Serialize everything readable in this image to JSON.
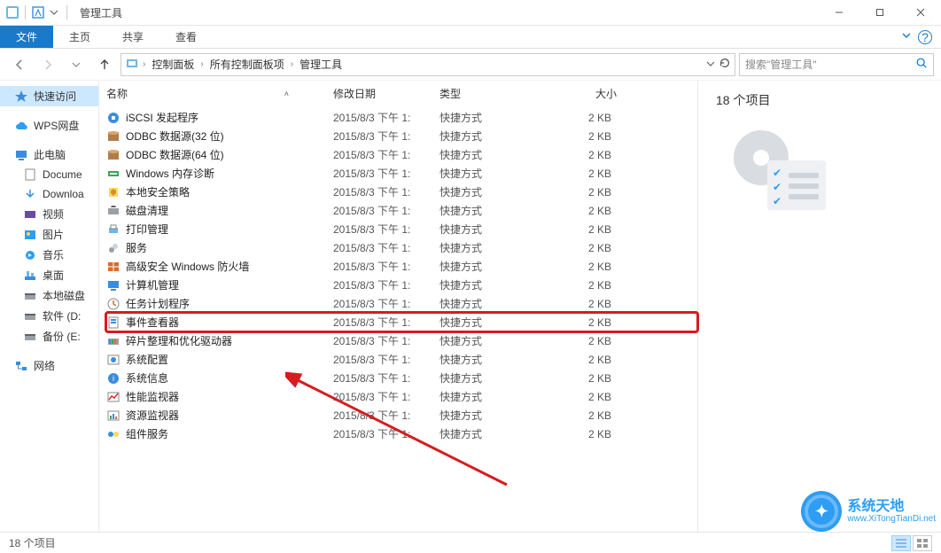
{
  "window": {
    "title": "管理工具"
  },
  "ribbon": {
    "file": "文件",
    "tabs": [
      "主页",
      "共享",
      "查看"
    ]
  },
  "address": {
    "crumbs": [
      "控制面板",
      "所有控制面板项",
      "管理工具"
    ]
  },
  "search": {
    "placeholder": "搜索\"管理工具\""
  },
  "sidebar": {
    "quick_access": "快速访问",
    "wps": "WPS网盘",
    "this_pc": "此电脑",
    "this_pc_children": [
      "Docume",
      "Downloa",
      "视频",
      "图片",
      "音乐",
      "桌面",
      "本地磁盘",
      "软件 (D:",
      "备份 (E:"
    ],
    "network": "网络"
  },
  "columns": {
    "name": "名称",
    "date": "修改日期",
    "type": "类型",
    "size": "大小"
  },
  "files": [
    {
      "name": "iSCSI 发起程序",
      "date": "2015/8/3 下午 1:",
      "type": "快捷方式",
      "size": "2 KB",
      "icon": "iscsi"
    },
    {
      "name": "ODBC 数据源(32 位)",
      "date": "2015/8/3 下午 1:",
      "type": "快捷方式",
      "size": "2 KB",
      "icon": "odbc"
    },
    {
      "name": "ODBC 数据源(64 位)",
      "date": "2015/8/3 下午 1:",
      "type": "快捷方式",
      "size": "2 KB",
      "icon": "odbc"
    },
    {
      "name": "Windows 内存诊断",
      "date": "2015/8/3 下午 1:",
      "type": "快捷方式",
      "size": "2 KB",
      "icon": "mem"
    },
    {
      "name": "本地安全策略",
      "date": "2015/8/3 下午 1:",
      "type": "快捷方式",
      "size": "2 KB",
      "icon": "secpol"
    },
    {
      "name": "磁盘清理",
      "date": "2015/8/3 下午 1:",
      "type": "快捷方式",
      "size": "2 KB",
      "icon": "cleanup"
    },
    {
      "name": "打印管理",
      "date": "2015/8/3 下午 1:",
      "type": "快捷方式",
      "size": "2 KB",
      "icon": "print"
    },
    {
      "name": "服务",
      "date": "2015/8/3 下午 1:",
      "type": "快捷方式",
      "size": "2 KB",
      "icon": "services"
    },
    {
      "name": "高级安全 Windows 防火墙",
      "date": "2015/8/3 下午 1:",
      "type": "快捷方式",
      "size": "2 KB",
      "icon": "firewall"
    },
    {
      "name": "计算机管理",
      "date": "2015/8/3 下午 1:",
      "type": "快捷方式",
      "size": "2 KB",
      "icon": "compmgmt"
    },
    {
      "name": "任务计划程序",
      "date": "2015/8/3 下午 1:",
      "type": "快捷方式",
      "size": "2 KB",
      "icon": "tasksched"
    },
    {
      "name": "事件查看器",
      "date": "2015/8/3 下午 1:",
      "type": "快捷方式",
      "size": "2 KB",
      "icon": "eventvwr",
      "highlight": true
    },
    {
      "name": "碎片整理和优化驱动器",
      "date": "2015/8/3 下午 1:",
      "type": "快捷方式",
      "size": "2 KB",
      "icon": "defrag"
    },
    {
      "name": "系统配置",
      "date": "2015/8/3 下午 1:",
      "type": "快捷方式",
      "size": "2 KB",
      "icon": "msconfig"
    },
    {
      "name": "系统信息",
      "date": "2015/8/3 下午 1:",
      "type": "快捷方式",
      "size": "2 KB",
      "icon": "sysinfo"
    },
    {
      "name": "性能监视器",
      "date": "2015/8/3 下午 1:",
      "type": "快捷方式",
      "size": "2 KB",
      "icon": "perfmon"
    },
    {
      "name": "资源监视器",
      "date": "2015/8/3 下午 1:",
      "type": "快捷方式",
      "size": "2 KB",
      "icon": "resmon"
    },
    {
      "name": "组件服务",
      "date": "2015/8/3 下午 1:",
      "type": "快捷方式",
      "size": "2 KB",
      "icon": "comsvcs"
    }
  ],
  "preview": {
    "count_label": "18 个项目"
  },
  "status": {
    "text": "18 个项目"
  },
  "watermark": {
    "cn": "系统天地",
    "en": "www.XiTongTianDi.net"
  }
}
